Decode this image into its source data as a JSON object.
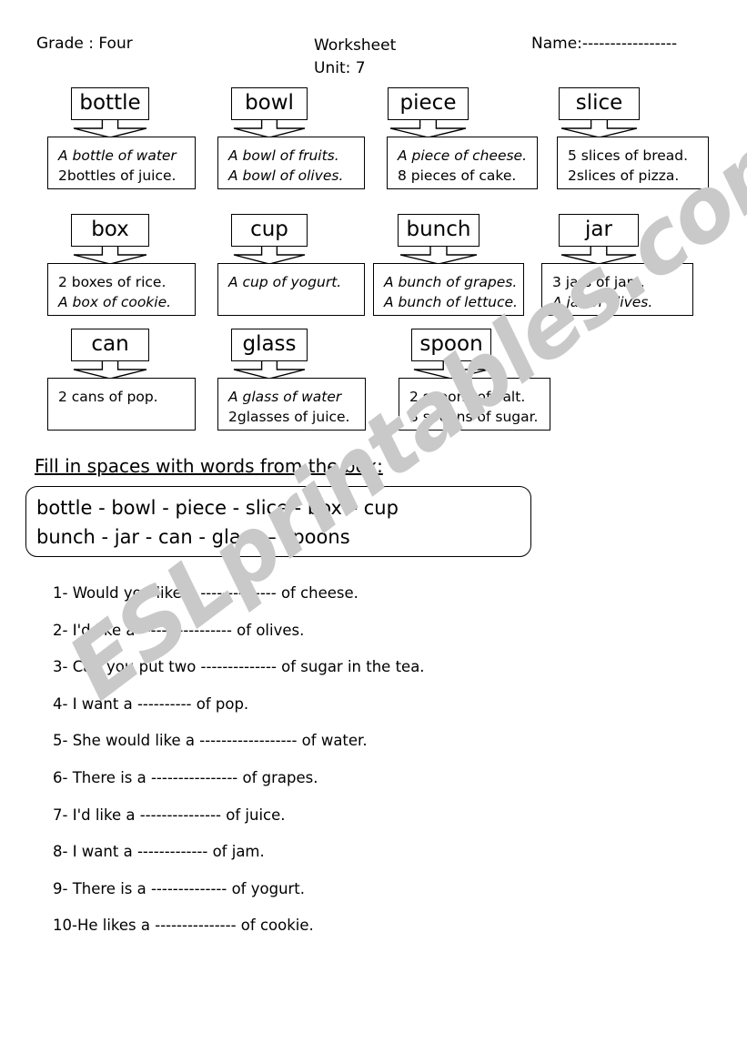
{
  "header": {
    "grade": "Grade : Four",
    "worksheet": "Worksheet",
    "unit": "Unit: 7",
    "name": "Name:-----------------"
  },
  "word_groups": [
    {
      "word": "bottle",
      "examples": [
        "A bottle of water",
        "2bottles of  juice."
      ]
    },
    {
      "word": "bowl",
      "examples": [
        "A bowl of fruits.",
        "A bowl of olives."
      ]
    },
    {
      "word": "piece",
      "examples": [
        "A piece of cheese.",
        "8 pieces of cake."
      ]
    },
    {
      "word": "slice",
      "examples": [
        "5 slices of bread.",
        "2slices of pizza."
      ]
    },
    {
      "word": "box",
      "examples": [
        "2 boxes of rice.",
        "A box of cookie."
      ]
    },
    {
      "word": "cup",
      "examples": [
        "A cup of yogurt.",
        ""
      ]
    },
    {
      "word": "bunch",
      "examples": [
        "A bunch of grapes.",
        "A bunch of lettuce."
      ]
    },
    {
      "word": "jar",
      "examples": [
        "3 jars of jam.",
        "A jar of olives."
      ]
    },
    {
      "word": "can",
      "examples": [
        "2 cans of pop.",
        ""
      ]
    },
    {
      "word": "glass",
      "examples": [
        "A glass of water",
        "2glasses of  juice."
      ]
    },
    {
      "word": "spoon",
      "examples": [
        "2 spoons of salt.",
        "3 spoons of sugar."
      ]
    }
  ],
  "instruction": "Fill in spaces with words from the box:",
  "word_bank": {
    "line1": "bottle -   bowl  - piece -  slice  -  box – cup",
    "line2": "bunch - jar  -  can  -  glass – spoons"
  },
  "questions": [
    "1-  Would you like a -------------- of cheese.",
    "2- I'd like a ----------------- of olives.",
    "3- Can you put two -------------- of sugar in the tea.",
    "4- I want a ---------- of pop.",
    "5- She would like a ------------------ of water.",
    "6- There is a ---------------- of grapes.",
    "7- I'd like a --------------- of juice.",
    "8- I want a ------------- of jam.",
    "9- There is a -------------- of yogurt.",
    "10-He likes a --------------- of cookie."
  ],
  "watermark": {
    "text": "ESLprintables.com",
    "color": "#c9c9c9"
  }
}
